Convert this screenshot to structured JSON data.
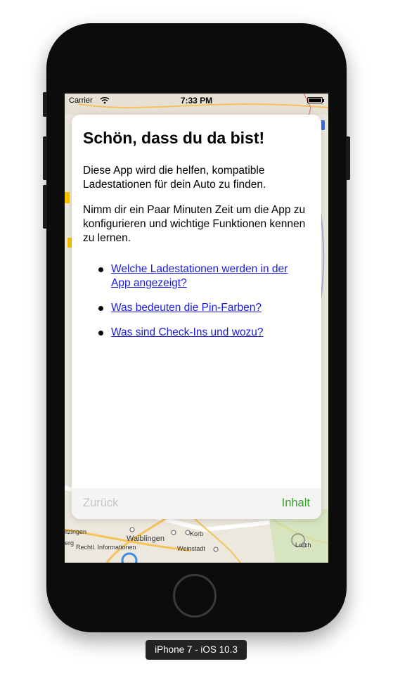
{
  "device": {
    "label": "iPhone 7 - iOS 10.3"
  },
  "status_bar": {
    "carrier": "Carrier",
    "time": "7:33 PM"
  },
  "map": {
    "places": {
      "waiblingen": "Waiblingen",
      "korb": "Korb",
      "weinstadt": "Weinstadt",
      "rechtl": "Rechtl. Informationen",
      "itzingen": "itzingen",
      "erg": "erg",
      "lorch": "Lorch"
    }
  },
  "dialog": {
    "title": "Schön, dass du da bist!",
    "paragraph1": "Diese App wird die helfen, kompatible Ladestationen für dein Auto zu finden.",
    "paragraph2": "Nimm dir ein Paar Minuten Zeit um die App zu konfigurieren und wichtige Funktionen kennen zu lernen.",
    "links": [
      {
        "label": "Welche Ladestationen werden in der App angezeigt?"
      },
      {
        "label": "Was bedeuten die Pin-Farben?"
      },
      {
        "label": "Was sind Check-Ins und wozu?"
      }
    ],
    "back_button": "Zurück",
    "next_button": "Inhalt"
  },
  "colors": {
    "link": "#1a1ae0",
    "next_button": "#3a9e34",
    "back_button_disabled": "#c4c4c4"
  }
}
